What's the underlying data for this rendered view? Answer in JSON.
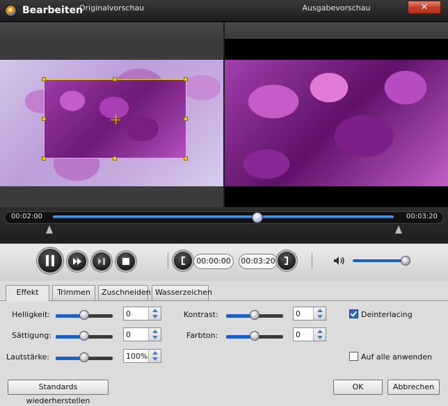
{
  "window": {
    "title": "Bearbeiten",
    "close_symbol": "✕"
  },
  "preview": {
    "original_label": "Originalvorschau",
    "output_label": "Ausgabevorschau"
  },
  "timeline": {
    "start_time": "00:02:00",
    "end_time": "00:03:20",
    "position_fraction": 0.58,
    "accent_color": "#1b5fc9"
  },
  "controls": {
    "pause_icon": "pause-icon",
    "fast_forward_icon": "fast-forward-icon",
    "step_icon": "step-icon",
    "stop_icon": "stop-icon",
    "set_start_icon": "bracket-open-icon",
    "start_time": "00:00:00",
    "end_time": "00:03:20",
    "set_end_icon": "bracket-close-icon",
    "volume_icon": "speaker-icon",
    "volume_fraction": 0.97
  },
  "tabs": [
    {
      "label": "Effekt",
      "active": true
    },
    {
      "label": "Trimmen",
      "active": false
    },
    {
      "label": "Zuschneiden",
      "active": false
    },
    {
      "label": "Wasserzeichen",
      "active": false
    }
  ],
  "effect": {
    "brightness": {
      "label": "Helligkeit:",
      "value": "0",
      "fraction": 0.5
    },
    "saturation": {
      "label": "Sättigung:",
      "value": "0",
      "fraction": 0.5
    },
    "volume": {
      "label": "Lautstärke:",
      "value": "100%",
      "fraction": 0.5
    },
    "contrast": {
      "label": "Kontrast:",
      "value": "0",
      "fraction": 0.5
    },
    "hue": {
      "label": "Farbton:",
      "value": "0",
      "fraction": 0.5
    },
    "deinterlacing": {
      "label": "Deinterlacing",
      "checked": true
    },
    "apply_all": {
      "label": "Auf alle anwenden",
      "checked": false
    }
  },
  "footer": {
    "reset_label": "Standards wiederherstellen",
    "ok_label": "OK",
    "cancel_label": "Abbrechen"
  }
}
